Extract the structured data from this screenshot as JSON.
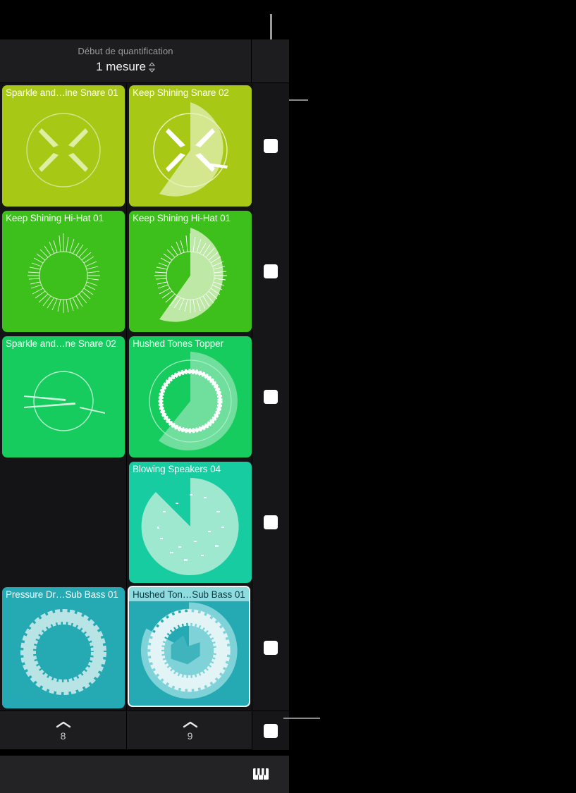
{
  "header": {
    "quantization_label": "Début de quantification",
    "quantization_value": "1 mesure",
    "stepper_icon": "stepper-updown-icon",
    "contrast_icon": "contrast-icon",
    "playstop_icon": "play-stop-toggle-icon"
  },
  "grid": {
    "rows": [
      {
        "cells": [
          {
            "title": "Sparkle and…ine Snare 01",
            "color": "#a8c816",
            "art": "#cfe38a",
            "playing": false,
            "progress": 0,
            "selected": false,
            "art_type": "snare-spikes"
          },
          {
            "title": "Keep Shining Snare 02",
            "color": "#a8c816",
            "art": "#d4e68e",
            "playing": true,
            "progress": 0.66,
            "selected": false,
            "art_type": "snare-spikes"
          }
        ],
        "stop_icon": "stop-button"
      },
      {
        "cells": [
          {
            "title": "Keep Shining Hi-Hat 01",
            "color": "#3dbf1c",
            "art": "#bde8a6",
            "playing": false,
            "progress": 0,
            "selected": false,
            "art_type": "hihat-ring"
          },
          {
            "title": "Keep Shining Hi-Hat 01",
            "color": "#3dbf1c",
            "art": "#bde8a6",
            "playing": true,
            "progress": 0.66,
            "selected": false,
            "art_type": "hihat-ring"
          }
        ],
        "stop_icon": "stop-button"
      },
      {
        "cells": [
          {
            "title": "Sparkle and…ne Snare 02",
            "color": "#17cc5e",
            "art": "#b5f0cd",
            "playing": false,
            "progress": 0,
            "selected": false,
            "art_type": "thin-circle"
          },
          {
            "title": "Hushed Tones Topper",
            "color": "#17cc5e",
            "art": "#bdf2d4",
            "playing": true,
            "progress": 0.56,
            "selected": false,
            "art_type": "topper-ring"
          }
        ],
        "stop_icon": "stop-button"
      },
      {
        "cells": [
          {
            "title": "",
            "color": "",
            "art": "",
            "playing": false,
            "progress": 0,
            "selected": false,
            "art_type": "empty",
            "empty": true
          },
          {
            "title": "Blowing Speakers 04",
            "color": "#17cca0",
            "art": "#9fe8d0",
            "playing": true,
            "progress": 0.92,
            "selected": false,
            "art_type": "speakers-disc"
          }
        ],
        "stop_icon": "stop-button"
      },
      {
        "cells": [
          {
            "title": "Pressure Dr…Sub Bass 01",
            "color": "#25a9b3",
            "art": "#b9e4e6",
            "playing": false,
            "progress": 0,
            "selected": false,
            "art_type": "subbass-ring"
          },
          {
            "title": "Hushed Ton…Sub Bass 01",
            "color": "#25a9b3",
            "art": "#c4e9ea",
            "playing": true,
            "progress": 0.65,
            "selected": true,
            "art_type": "subbass-ring2"
          }
        ],
        "stop_icon": "stop-button"
      }
    ]
  },
  "footer": {
    "columns": [
      {
        "chevron_icon": "chevron-up-icon",
        "number": "8"
      },
      {
        "chevron_icon": "chevron-up-icon",
        "number": "9"
      }
    ],
    "stop_icon": "stop-button"
  },
  "bottombar": {
    "keyboard_icon": "piano-keyboard-icon"
  }
}
